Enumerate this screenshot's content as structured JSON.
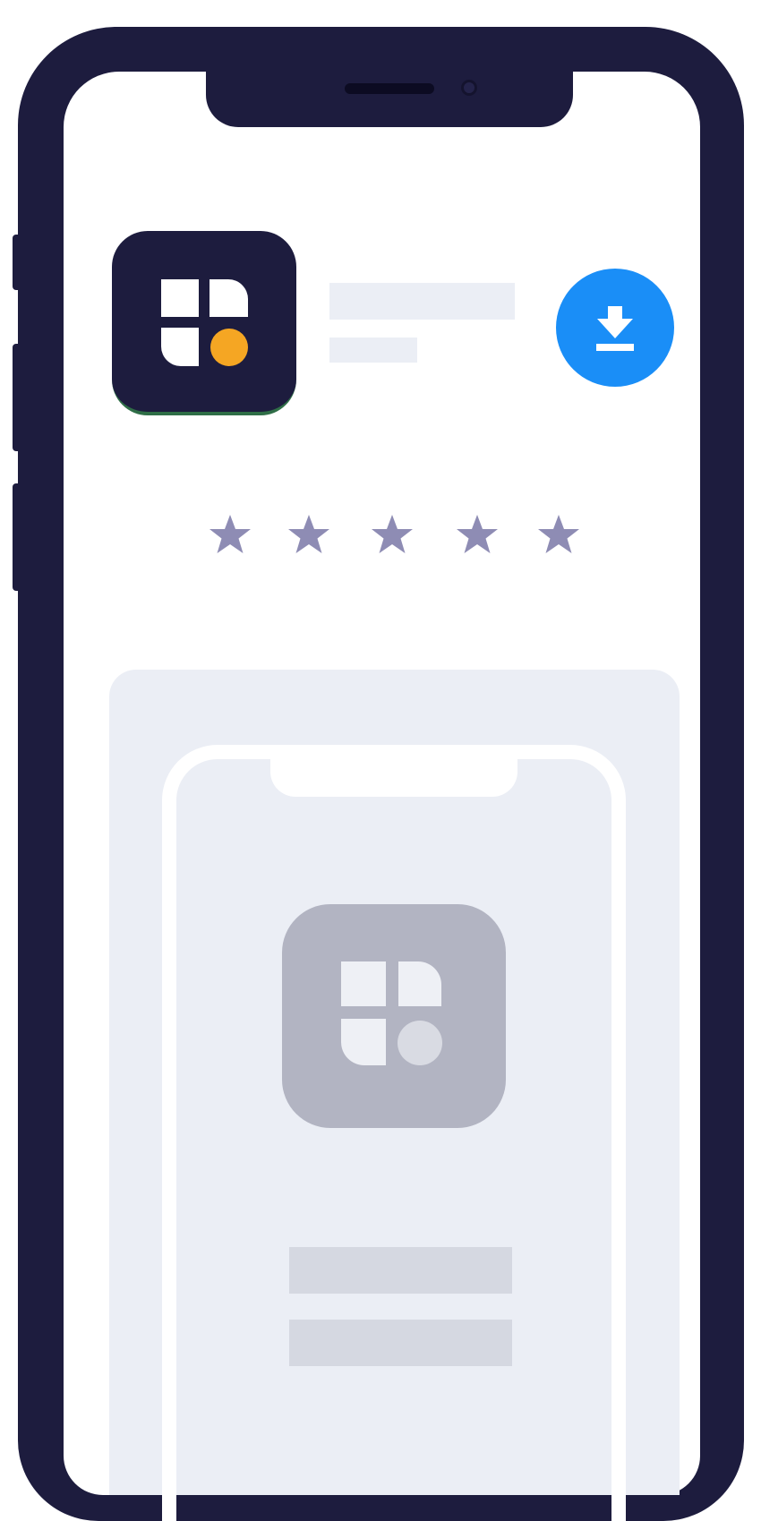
{
  "colors": {
    "device_frame": "#1d1c3e",
    "screen_background": "#ffffff",
    "app_icon_background": "#1d1c3e",
    "app_icon_accent": "#f5a623",
    "download_button": "#1a8ef7",
    "star": "#8e8cb4",
    "placeholder_light": "#ebeef5",
    "placeholder_mid": "#d5d8e1",
    "preview_icon_background": "#b2b4c2"
  },
  "app_icon": {
    "icon": "grid-tiles-icon"
  },
  "download_button": {
    "icon": "download-icon"
  },
  "rating": {
    "stars_shown": 5,
    "icon": "star-icon"
  },
  "preview": {
    "icon": "grid-tiles-icon"
  }
}
